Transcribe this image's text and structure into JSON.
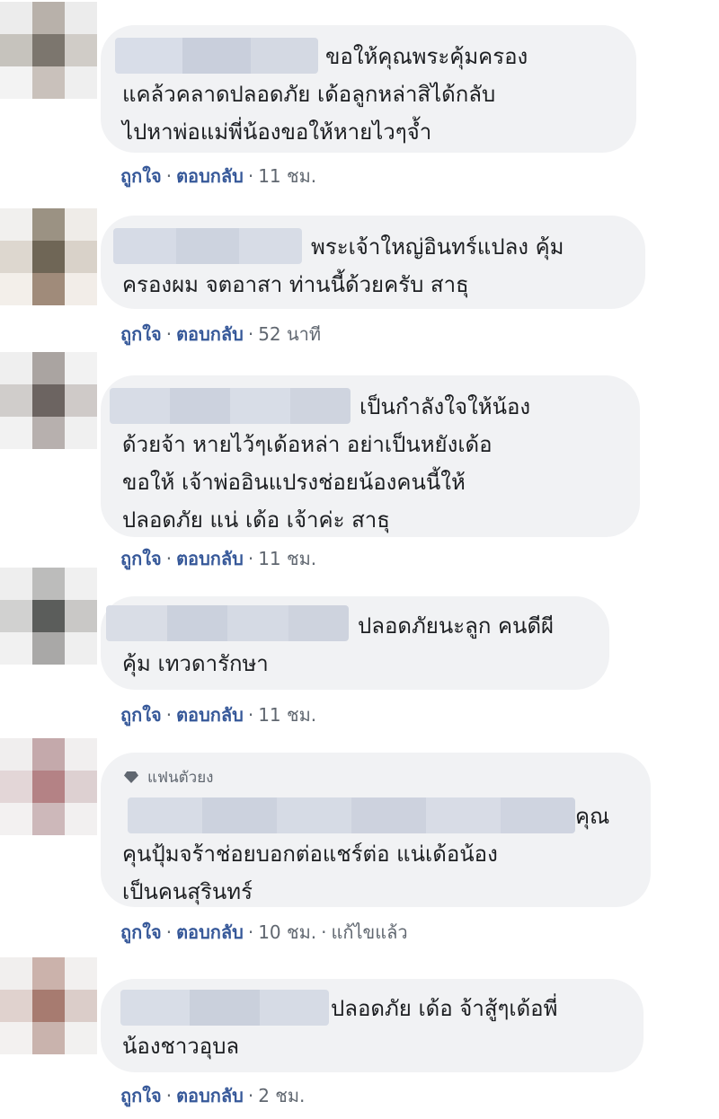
{
  "comments": [
    {
      "text_first": "ขอให้คุณพระคุ้มครอง",
      "text_rest": "แคล้วคลาดปลอดภัย เด้อลูกหล่าสิได้กลับ\nไปหาพ่อแม่พี่น้องขอให้หายไวๆจ้ำ",
      "like": "ถูกใจ",
      "reply": "ตอบกลับ",
      "time": "11 ชม."
    },
    {
      "text_first": "พระเจ้าใหญ่อินทร์แปลง คุ้ม",
      "text_rest": "ครองผม จตอาสา ท่านนี้ด้วยครับ สาธุ",
      "like": "ถูกใจ",
      "reply": "ตอบกลับ",
      "time": "52 นาที"
    },
    {
      "text_first": "เป็นกำลังใจให้น้อง",
      "text_rest": "ด้วยจ้า หายไว้ๆเด้อหล่า อย่าเป็นหยังเด้อ\nขอให้ เจ้าพ่ออินแปรงช่อยน้องคนนี้ให้\nปลอดภัย แน่ เด้อ เจ้าค่ะ สาธุ",
      "like": "ถูกใจ",
      "reply": "ตอบกลับ",
      "time": "11 ชม."
    },
    {
      "text_first": "ปลอดภัยนะลูก คนดีผี",
      "text_rest": "คุ้ม เทวดารักษา",
      "like": "ถูกใจ",
      "reply": "ตอบกลับ",
      "time": "11 ชม."
    },
    {
      "badge": "แฟนตัวยง",
      "text_first": "คุณ",
      "text_rest": "คุนปุ้มจร้าช่อยบอกต่อแชร์ต่อ แน่เด้อน้อง\nเป็นคนสุรินทร์",
      "like": "ถูกใจ",
      "reply": "ตอบกลับ",
      "time": "10 ชม.",
      "edited": "แก้ไขแล้ว"
    },
    {
      "text_first": "ปลอดภัย เด้อ จ้าสู้ๆเด้อพี่",
      "text_rest": "น้องชาวอุบล",
      "like": "ถูกใจ",
      "reply": "ตอบกลับ",
      "time": "2 ชม."
    }
  ],
  "separator": "·",
  "colors": {
    "bubble": "#f1f2f4",
    "link": "#365899",
    "meta": "#606770",
    "text": "#1c1e21"
  }
}
